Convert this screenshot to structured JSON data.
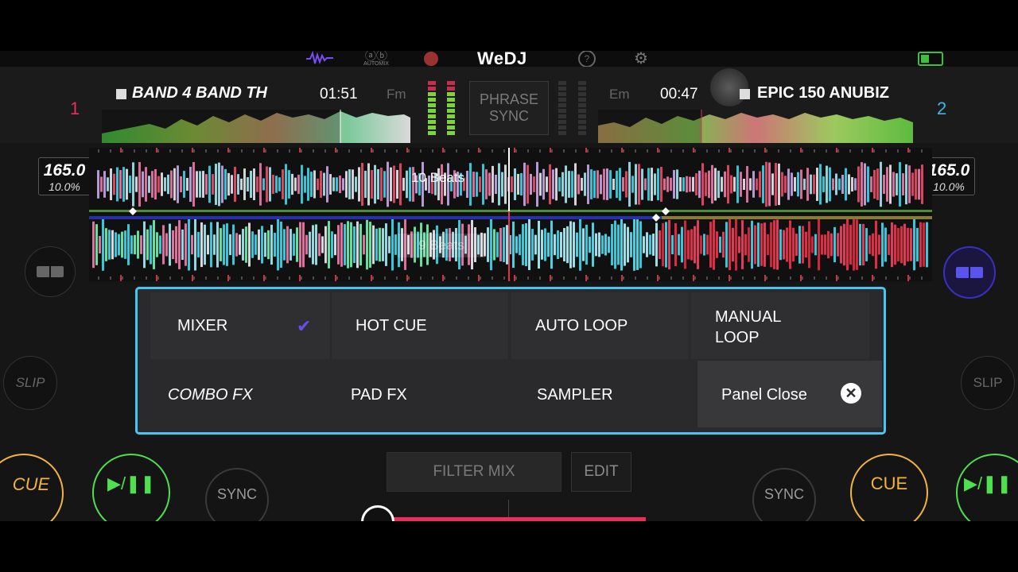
{
  "app": {
    "logo": "WeDJ",
    "automix_label": "AUTOMIX"
  },
  "topbar_icons": [
    "waveform-icon",
    "automix-icon",
    "record-icon",
    "help-icon",
    "settings-icon",
    "battery-icon"
  ],
  "deck1": {
    "number": "1",
    "title": "BAND 4 BAND TH",
    "time": "01:51",
    "key": "Fm",
    "bpm": "165.0",
    "pitch": "10.0%",
    "color": "#e8305a"
  },
  "deck2": {
    "number": "2",
    "title": "EPIC 150 ANUBIZ",
    "time": "00:47",
    "key": "Em",
    "bpm": "165.0",
    "pitch": "10.0%",
    "color": "#3fb4e8"
  },
  "phrase_sync": {
    "line1": "PHRASE",
    "line2": "SYNC"
  },
  "waveform": {
    "beats_top": "10 Beats",
    "beats_bottom": "9 Beats"
  },
  "panel": {
    "row1": [
      "MIXER",
      "HOT CUE",
      "AUTO LOOP",
      "MANUAL LOOP"
    ],
    "row2": [
      "COMBO FX",
      "PAD FX",
      "SAMPLER",
      "Panel Close"
    ],
    "selected": "MIXER",
    "border_color": "#49c6ef",
    "check_color": "#6a4cf0"
  },
  "controls": {
    "slip": "SLIP",
    "cue": "CUE",
    "sync": "SYNC",
    "play": "▶/❚❚",
    "filter_mix": "FILTER MIX",
    "edit": "EDIT"
  },
  "colors": {
    "cue": "#f2b53a",
    "play": "#4ee04e",
    "crossfader": "#e8305a"
  }
}
